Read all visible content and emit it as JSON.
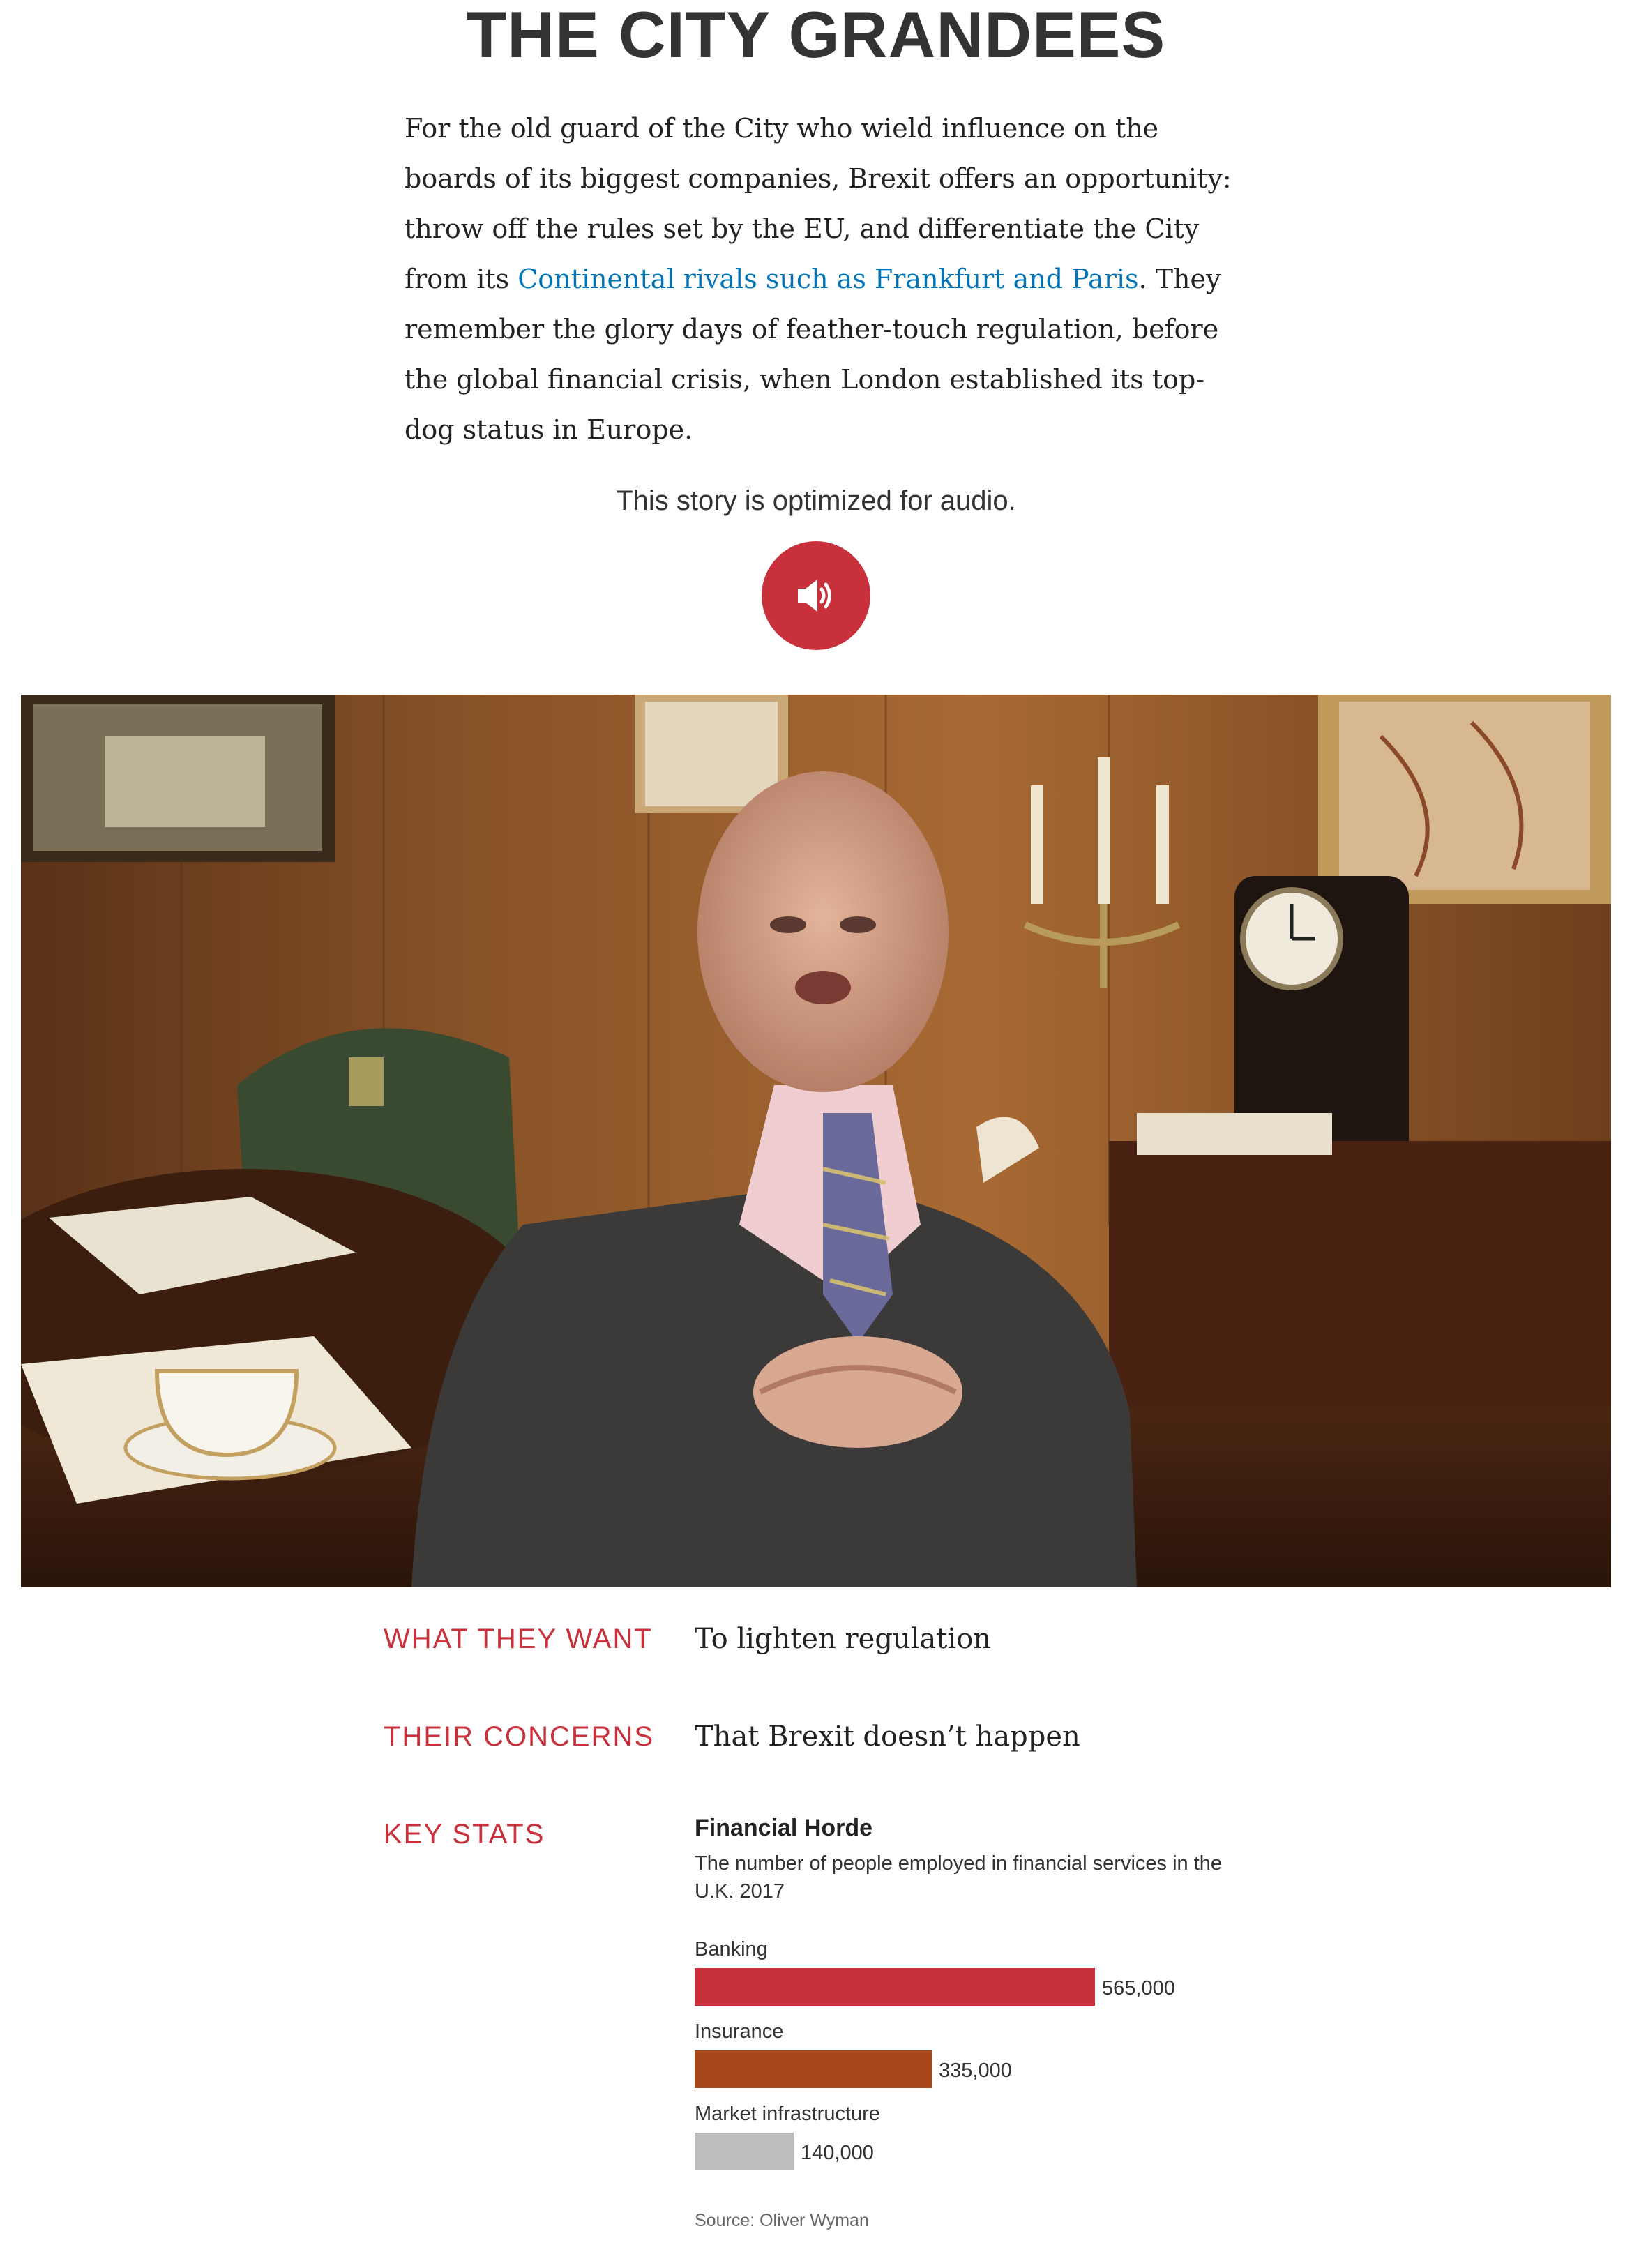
{
  "headline": "THE CITY GRANDEES",
  "intro": {
    "text_before": "For the old guard of the City who wield influence on the boards of its biggest companies, Brexit offers an opportunity: throw off the rules set by the EU, and differentiate the City from its ",
    "link_text": "Continental rivals such as Frankfurt and Paris",
    "text_after": ". They remember the glory days of feather-touch regulation, before the global financial crisis, when London established its top-dog status in Europe."
  },
  "audio": {
    "note": "This story is optimized for audio.",
    "icon": "speaker-icon",
    "button_color": "#c8313b"
  },
  "profile": {
    "want_label": "WHAT THEY WANT",
    "want_value": "To lighten regulation",
    "concerns_label": "THEIR CONCERNS",
    "concerns_value": "That Brexit doesn’t happen",
    "stats_label": "KEY STATS"
  },
  "chart_data": {
    "type": "bar",
    "orientation": "horizontal",
    "title": "Financial Horde",
    "subtitle": "The number of people employed in financial services in the U.K. 2017",
    "categories": [
      "Banking",
      "Insurance",
      "Market infrastructure"
    ],
    "values": [
      565000,
      335000,
      140000
    ],
    "value_labels": [
      "565,000",
      "335,000",
      "140,000"
    ],
    "colors": [
      "#c8313b",
      "#a8471a",
      "#bdbdbd"
    ],
    "xlim": [
      0,
      565000
    ],
    "grid": false,
    "source": "Source: Oliver Wyman"
  },
  "colors": {
    "accent_red": "#c8313b",
    "link_blue": "#0274b6"
  }
}
